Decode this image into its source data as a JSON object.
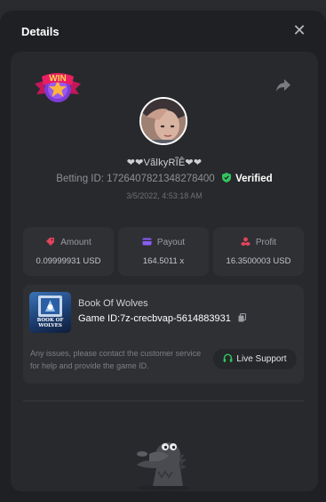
{
  "modal": {
    "title": "Details",
    "close_icon": "close-icon"
  },
  "badge": {
    "text": "WIN"
  },
  "bet": {
    "username": "❤❤VãlkyRĨÊ❤❤",
    "betting_id_label": "Betting ID: 1726407821348278400",
    "verified_label": "Verified",
    "date": "3/5/2022, 4:53:18 AM"
  },
  "stats": [
    {
      "label": "Amount",
      "value": "0.09999931 USD",
      "icon": "dollar-tag-icon",
      "color": "#e2445c"
    },
    {
      "label": "Payout",
      "value": "164.5011 x",
      "icon": "card-icon",
      "color": "#8a5cf6"
    },
    {
      "label": "Profit",
      "value": "16.3500003 USD",
      "icon": "coins-icon",
      "color": "#e2445c"
    }
  ],
  "game": {
    "name": "Book Of Wolves",
    "thumb_text": "BOOK OF WOLVES",
    "id_label": "Game ID:7z-crecbvap-5614883931",
    "note": "Any issues, please contact the customer service for help and provide the game ID.",
    "support_label": "Live Support"
  },
  "colors": {
    "accent_green": "#32c55e",
    "background": "#1f2023",
    "card": "#28292c"
  }
}
